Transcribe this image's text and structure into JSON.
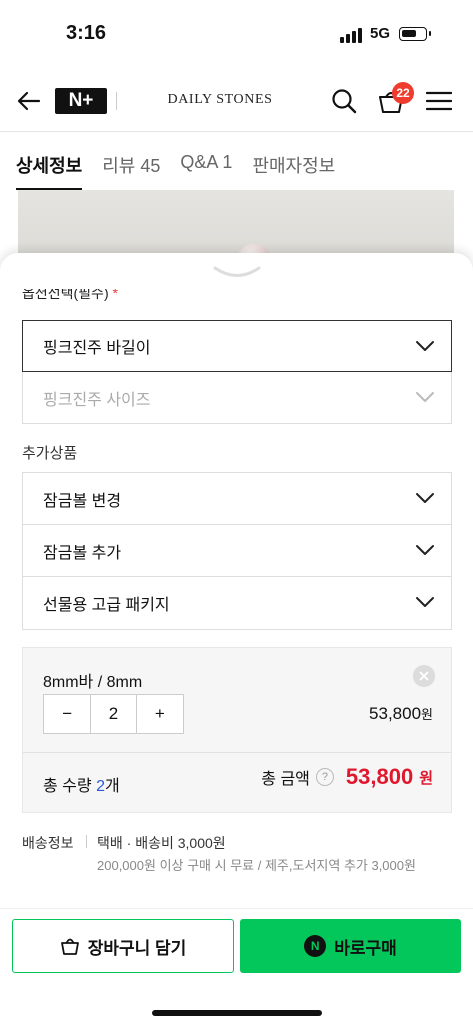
{
  "status": {
    "time": "3:16",
    "network": "5G"
  },
  "header": {
    "logo": "N+",
    "store_name": "DAILY STONES",
    "cart_count": "22"
  },
  "tabs": [
    {
      "label": "상세정보"
    },
    {
      "label": "리뷰 45"
    },
    {
      "label": "Q&A 1"
    },
    {
      "label": "판매자정보"
    }
  ],
  "options": {
    "title": "옵션선택(필수)",
    "required_mark": "*",
    "select1": "핑크진주 바길이",
    "select2_placeholder": "핑크진주 사이즈"
  },
  "addons": {
    "title": "추가상품",
    "items": [
      {
        "label": "잠금볼 변경"
      },
      {
        "label": "잠금볼 추가"
      },
      {
        "label": "선물용 고급 패키지"
      }
    ]
  },
  "selected": {
    "name": "8mm바 / 8mm",
    "minus": "−",
    "quantity": "2",
    "plus": "+",
    "price": "53,800",
    "price_unit": "원",
    "total_qty_label": "총 수량",
    "total_qty_value": "2",
    "total_qty_unit": "개",
    "total_label": "총 금액",
    "help": "?",
    "total_price": "53,800",
    "total_unit": "원"
  },
  "shipping": {
    "label": "배송정보",
    "fee": "택배 · 배송비 3,000원",
    "note": "200,000원 이상 구매 시 무료 / 제주,도서지역 추가 3,000원"
  },
  "actions": {
    "cart": "장바구니 담기",
    "buy": "바로구매",
    "npay": "N"
  },
  "colors": {
    "accent_green": "#03c75a",
    "price_red": "#e0182e",
    "badge_red": "#f03c2e"
  }
}
